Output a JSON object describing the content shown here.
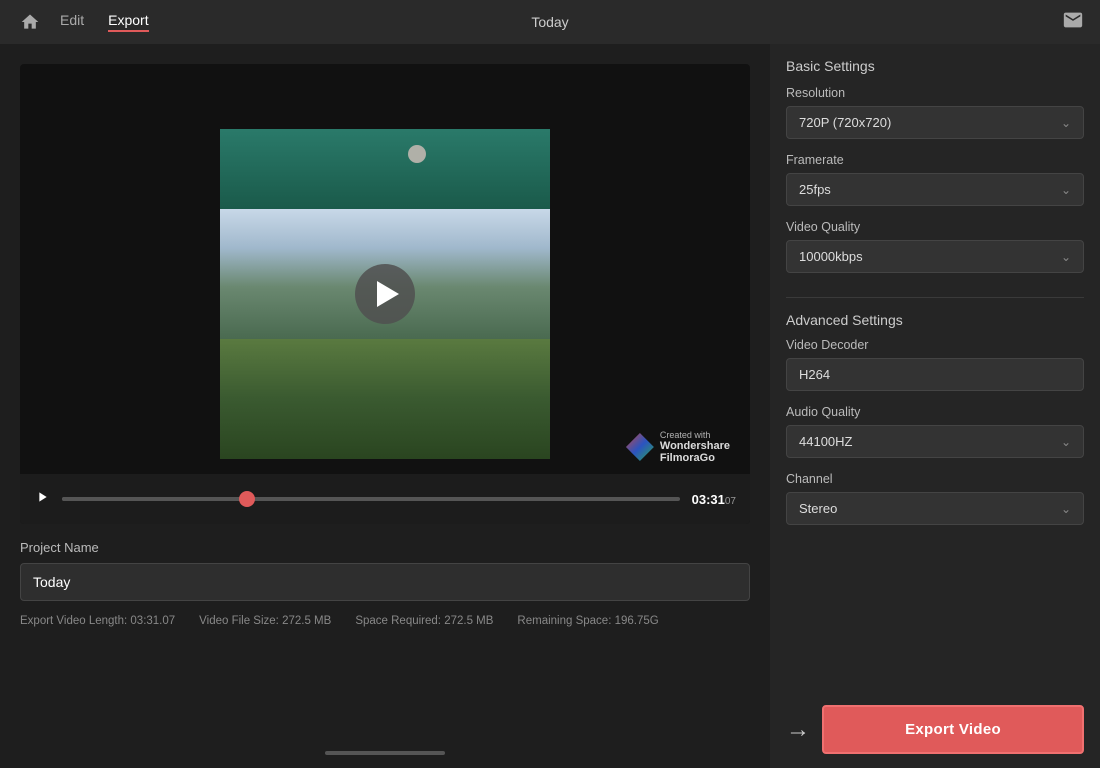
{
  "nav": {
    "home_icon": "home",
    "edit_label": "Edit",
    "export_label": "Export",
    "title": "Today",
    "mail_icon": "mail"
  },
  "video": {
    "play_icon": "play",
    "time_current": "03:31",
    "time_current_small": "07",
    "watermark_created": "Created with",
    "watermark_brand": "Wondershare\nFilmoraGo"
  },
  "project": {
    "label": "Project Name",
    "name_value": "Today"
  },
  "export_info": {
    "video_length_label": "Export Video Length:",
    "video_length_value": "03:31.07",
    "file_size_label": "Video File Size:",
    "file_size_value": "272.5 MB",
    "space_required_label": "Space Required:",
    "space_required_value": "272.5 MB",
    "remaining_label": "Remaining Space:",
    "remaining_value": "196.75G"
  },
  "settings": {
    "basic_title": "Basic Settings",
    "resolution_label": "Resolution",
    "resolution_value": "720P (720x720)",
    "framerate_label": "Framerate",
    "framerate_value": "25fps",
    "video_quality_label": "Video Quality",
    "video_quality_value": "10000kbps",
    "advanced_title": "Advanced Settings",
    "video_decoder_label": "Video Decoder",
    "video_decoder_value": "H264",
    "audio_quality_label": "Audio Quality",
    "audio_quality_value": "44100HZ",
    "channel_label": "Channel",
    "channel_value": "Stereo"
  },
  "export_button": {
    "label": "Export Video",
    "arrow": "→"
  }
}
